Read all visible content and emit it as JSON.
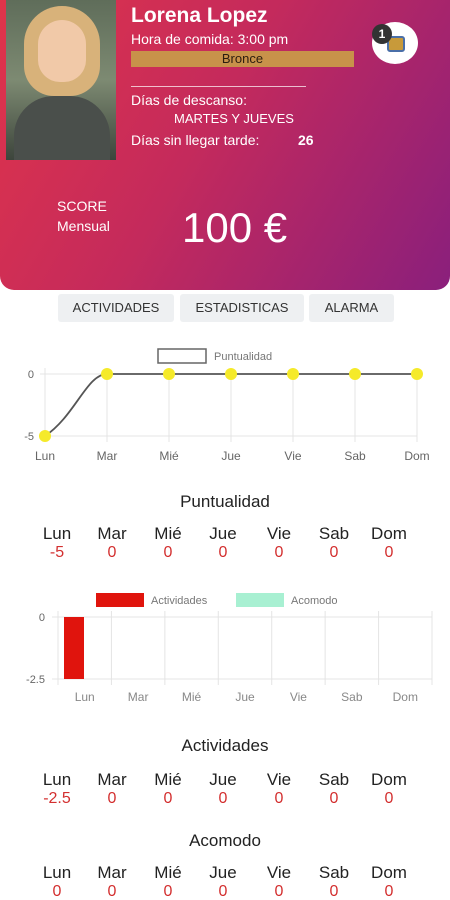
{
  "profile": {
    "name": "Lorena Lopez",
    "lunch_time": "Hora de comida: 3:00 pm",
    "level": "Bronce",
    "rest_label": "Días de descanso:",
    "rest_days": "MARTES Y JUEVES",
    "late_label": "Días sin llegar tarde:",
    "late_value": "26",
    "badge_count": "1",
    "badge_icon": "gift-icon"
  },
  "score": {
    "label_line1": "SCORE",
    "label_line2": "Mensual",
    "value": "100 €"
  },
  "tabs": [
    "ACTIVIDADES",
    "ESTADISTICAS",
    "ALARMA"
  ],
  "days": [
    "Lun",
    "Mar",
    "Mié",
    "Jue",
    "Vie",
    "Sab",
    "Dom"
  ],
  "colors": {
    "accent_red": "#d32f2f",
    "point_yellow": "#f5ea2a",
    "bar_red": "#e0140d",
    "legend_mint": "#a8f0d2"
  },
  "chart_data": [
    {
      "type": "line",
      "series": [
        {
          "name": "Puntualidad",
          "values": [
            -5,
            0,
            0,
            0,
            0,
            0,
            0
          ]
        }
      ],
      "categories": [
        "Lun",
        "Mar",
        "Mié",
        "Jue",
        "Vie",
        "Sab",
        "Dom"
      ],
      "yticks": [
        "0",
        "-5"
      ],
      "ylim": [
        -5,
        0
      ]
    },
    {
      "type": "bar",
      "series": [
        {
          "name": "Actividades",
          "values": [
            -2.5,
            0,
            0,
            0,
            0,
            0,
            0
          ]
        },
        {
          "name": "Acomodo",
          "values": [
            0,
            0,
            0,
            0,
            0,
            0,
            0
          ]
        }
      ],
      "categories": [
        "Lun",
        "Mar",
        "Mié",
        "Jue",
        "Vie",
        "Sab",
        "Dom"
      ],
      "yticks": [
        "0",
        "-2.5"
      ],
      "ylim": [
        -2.5,
        0
      ]
    }
  ],
  "summaries": [
    {
      "title": "Puntualidad",
      "values": [
        "-5",
        "0",
        "0",
        "0",
        "0",
        "0",
        "0"
      ]
    },
    {
      "title": "Actividades",
      "values": [
        "-2.5",
        "0",
        "0",
        "0",
        "0",
        "0",
        "0"
      ]
    },
    {
      "title": "Acomodo",
      "values": [
        "0",
        "0",
        "0",
        "0",
        "0",
        "0",
        "0"
      ]
    }
  ]
}
